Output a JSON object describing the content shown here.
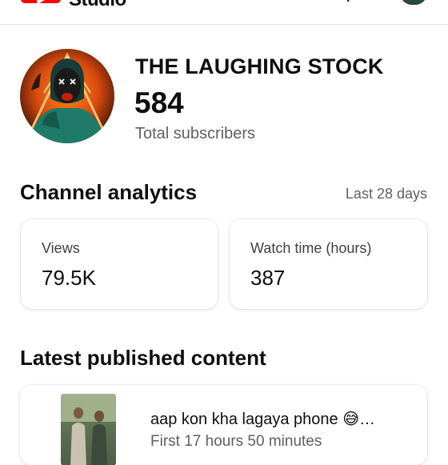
{
  "app": {
    "title": "Studio"
  },
  "channel": {
    "name": "THE LAUGHING STOCK",
    "subscriber_count": "584",
    "subscriber_label": "Total subscribers"
  },
  "analytics": {
    "heading": "Channel analytics",
    "range": "Last 28 days",
    "cards": [
      {
        "label": "Views",
        "value": "79.5K"
      },
      {
        "label": "Watch time (hours)",
        "value": "387"
      }
    ]
  },
  "latest": {
    "heading": "Latest published content",
    "video": {
      "title": "aap kon kha lagaya phone 😅…",
      "meta": "First 17 hours 50 minutes"
    }
  },
  "icons": {
    "logo": "youtube-logo-icon",
    "help": "help-icon",
    "account": "account-avatar-icon"
  },
  "colors": {
    "brand": "#ff0000",
    "text": "#0f0f0f",
    "secondary_text": "#606060"
  }
}
